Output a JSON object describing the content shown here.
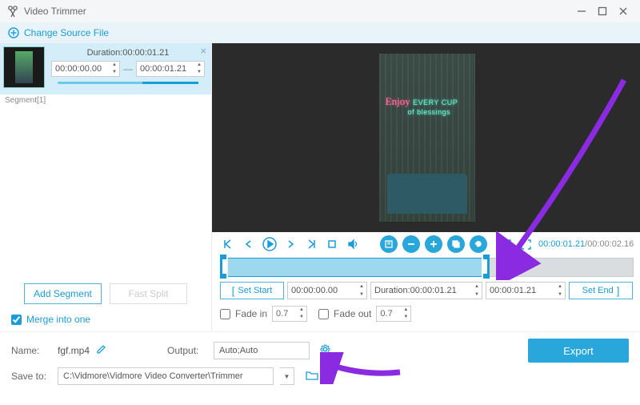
{
  "app": {
    "title": "Video Trimmer"
  },
  "source": {
    "change_label": "Change Source File"
  },
  "segment": {
    "label": "Segment[1]",
    "duration_label": "Duration:",
    "duration_value": "00:00:01.21",
    "start": "00:00:00.00",
    "end": "00:00:01.21"
  },
  "left": {
    "add_segment": "Add Segment",
    "fast_split": "Fast Split",
    "merge_label": "Merge into one"
  },
  "preview": {
    "neon_line1": "Enjoy",
    "neon_line2a": "EVERY CUP",
    "neon_line2b": "of blessings"
  },
  "playback": {
    "current": "00:00:01.21",
    "total": "00:00:02.16"
  },
  "trim": {
    "set_start": "Set Start",
    "start_time": "00:00:00.00",
    "duration_label": "Duration:",
    "duration_value": "00:00:01.21",
    "end_time": "00:00:01.21",
    "set_end": "Set End"
  },
  "fade": {
    "in_label": "Fade in",
    "in_value": "0.7",
    "out_label": "Fade out",
    "out_value": "0.7"
  },
  "bottom": {
    "name_label": "Name:",
    "name_value": "fgf.mp4",
    "output_label": "Output:",
    "output_value": "Auto;Auto",
    "export_label": "Export",
    "save_label": "Save to:",
    "save_path": "C:\\Vidmore\\Vidmore Video Converter\\Trimmer"
  }
}
